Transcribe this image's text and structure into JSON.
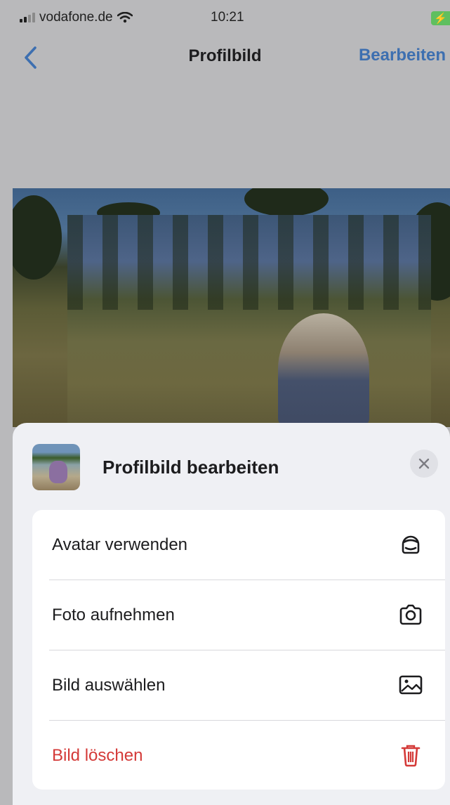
{
  "status_bar": {
    "carrier": "vodafone.de",
    "time": "10:21"
  },
  "nav": {
    "title": "Profilbild",
    "edit_label": "Bearbeiten"
  },
  "sheet": {
    "title": "Profilbild bearbeiten",
    "options": [
      {
        "label": "Avatar verwenden",
        "icon": "avatar-icon"
      },
      {
        "label": "Foto aufnehmen",
        "icon": "camera-icon"
      },
      {
        "label": "Bild auswählen",
        "icon": "photo-icon"
      },
      {
        "label": "Bild löschen",
        "icon": "trash-icon",
        "destructive": true
      }
    ]
  },
  "colors": {
    "accent": "#3d6fb0",
    "destructive": "#d43a38",
    "battery": "#5fbf5f"
  }
}
